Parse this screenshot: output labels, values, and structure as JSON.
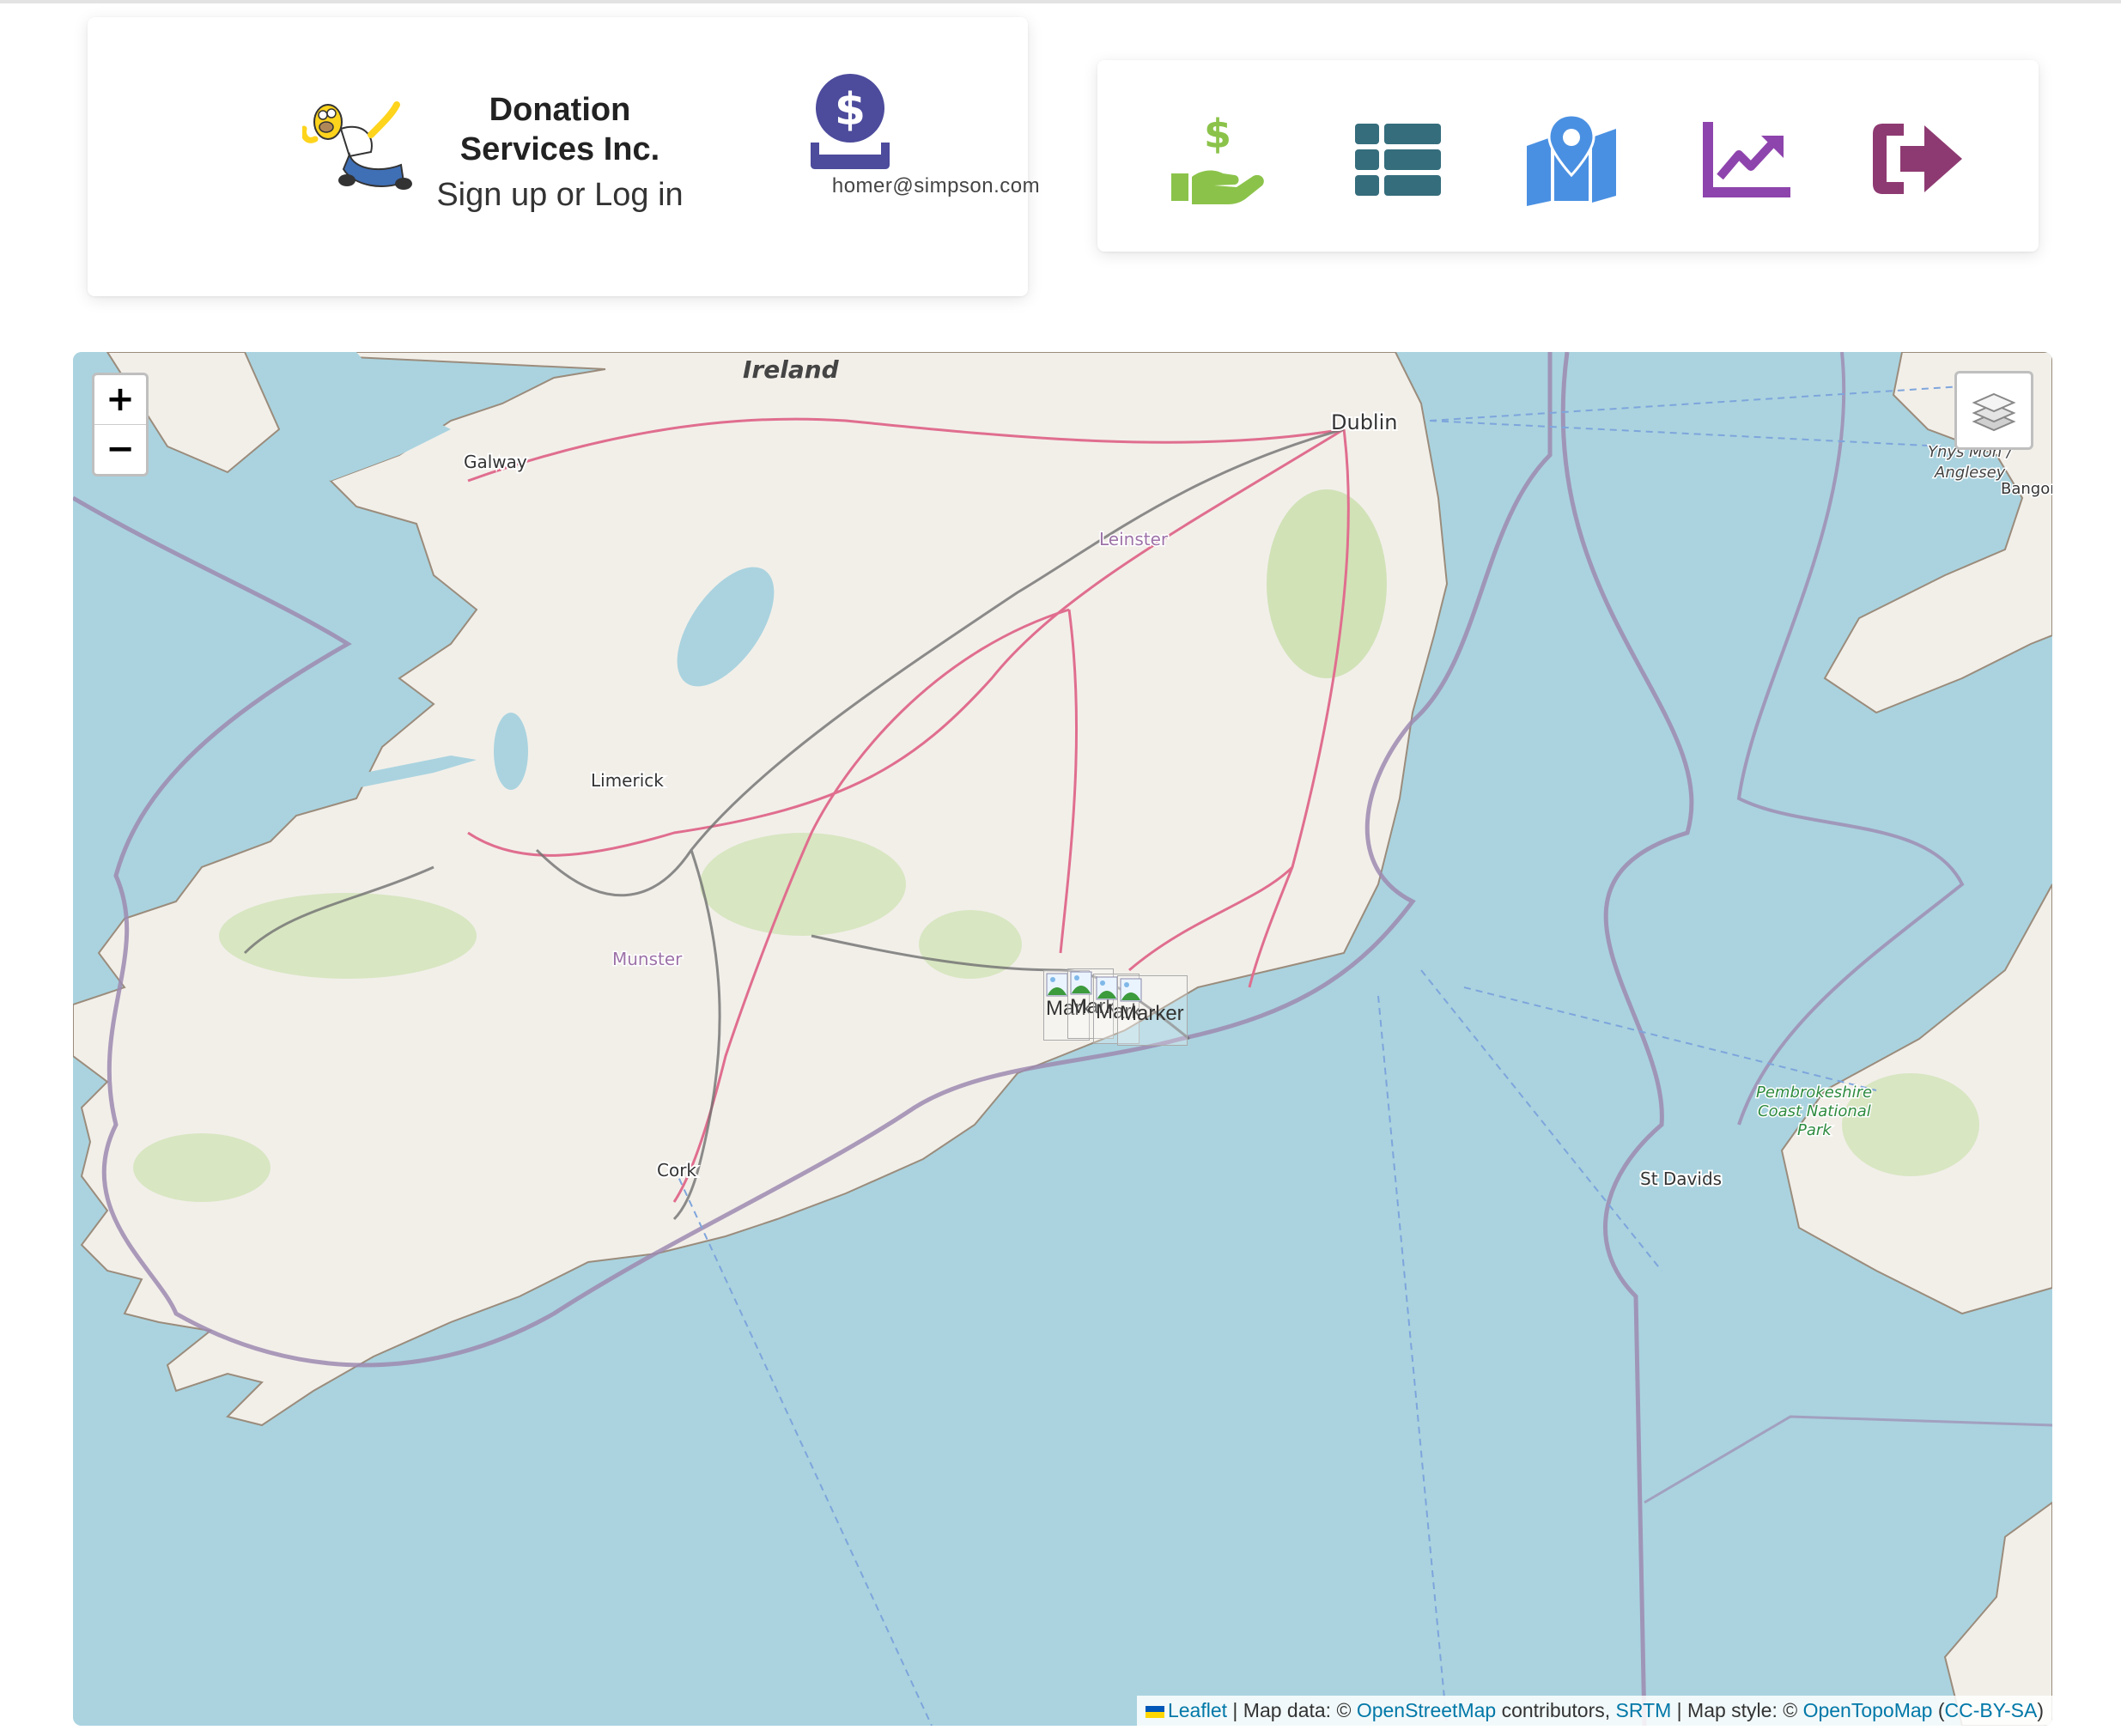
{
  "header": {
    "title": "Donation Services Inc.",
    "subtitle": "Sign up or Log in",
    "user_email": "homer@simpson.com"
  },
  "nav": {
    "items": [
      {
        "icon": "donate-hand-icon",
        "color": "#8bc34a"
      },
      {
        "icon": "list-icon",
        "color": "#356d7c"
      },
      {
        "icon": "map-marker-icon",
        "color": "#4a90e2"
      },
      {
        "icon": "chart-line-icon",
        "color": "#8e44ad"
      },
      {
        "icon": "sign-out-icon",
        "color": "#8e3a72"
      }
    ]
  },
  "colors": {
    "user_icon": "#4c4b9c",
    "water": "#aad3df",
    "land": "#f2efe9"
  },
  "map": {
    "zoom_in": "+",
    "zoom_out": "−",
    "labels": {
      "ireland": "Ireland",
      "dublin": "Dublin",
      "galway": "Galway",
      "leinster": "Leinster",
      "limerick": "Limerick",
      "munster": "Munster",
      "cork": "Cork",
      "ynys_mon": "Ynys Môn /",
      "anglesey": "Anglesey",
      "bangor": "Bangor",
      "pembrokeshire_1": "Pembrokeshire",
      "pembrokeshire_2": "Coast National",
      "pembrokeshire_3": "Park",
      "st_davids": "St Davids"
    },
    "markers": [
      {
        "label": "Marker"
      },
      {
        "label": "Marker"
      },
      {
        "label": "Marker"
      },
      {
        "label": "Marker"
      }
    ],
    "attribution": {
      "leaflet": "Leaflet",
      "map_data": " | Map data: © ",
      "osm": "OpenStreetMap",
      "contributors": " contributors, ",
      "srtm": "SRTM",
      "map_style": " | Map style: © ",
      "opentopomap": "OpenTopoMap",
      "license_open": " (",
      "license": "CC-BY-SA",
      "license_close": ")"
    }
  }
}
